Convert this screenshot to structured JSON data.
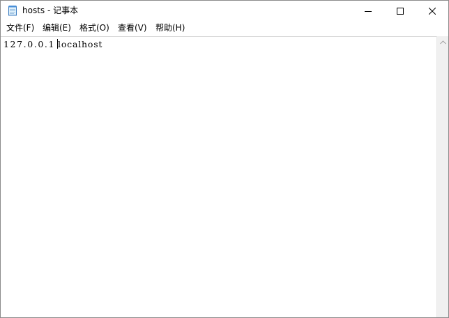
{
  "window": {
    "file_name": "hosts",
    "separator": " - ",
    "app_name": "记事本"
  },
  "menu": [
    {
      "label": "文件(F)"
    },
    {
      "label": "编辑(E)"
    },
    {
      "label": "格式(O)"
    },
    {
      "label": "查看(V)"
    },
    {
      "label": "帮助(H)"
    }
  ],
  "editor": {
    "ip": "127.0.0.1",
    "host": "localhost"
  },
  "icons": {
    "app": "notepad-icon",
    "minimize": "minimize-icon",
    "maximize": "maximize-icon",
    "close": "close-icon",
    "scroll_up": "scroll-up-arrow-icon"
  }
}
